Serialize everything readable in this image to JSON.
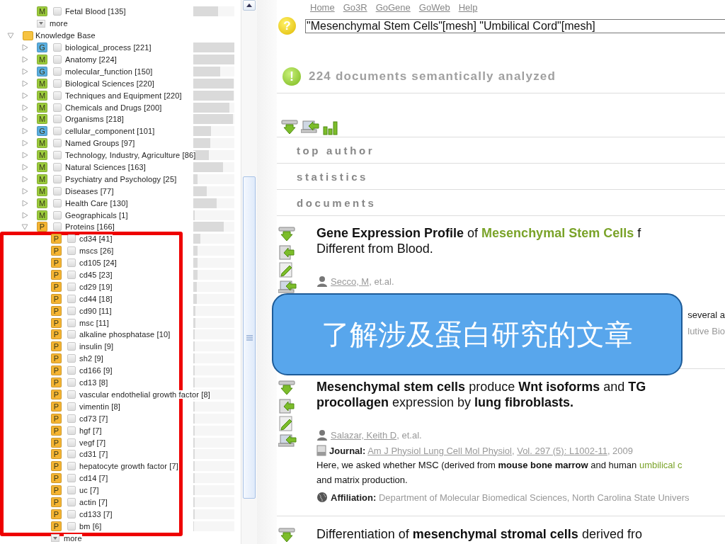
{
  "tree": {
    "top_items": [
      {
        "badge": "M",
        "color": "#9ccc3c",
        "label": "Fetal Blood [135]",
        "checked": false,
        "level": 0.6
      }
    ],
    "top_more": "more",
    "root": {
      "label": "Knowledge Base",
      "expanded": true,
      "children": [
        {
          "badge": "G",
          "color": "#5aaee0",
          "label": "biological_process [221]",
          "checked": false,
          "expanded": false,
          "level": 1.0
        },
        {
          "badge": "M",
          "color": "#9ccc3c",
          "label": "Anatomy [224]",
          "checked": false,
          "expanded": false,
          "level": 1.0
        },
        {
          "badge": "G",
          "color": "#5aaee0",
          "label": "molecular_function [150]",
          "checked": false,
          "expanded": false,
          "level": 0.66
        },
        {
          "badge": "M",
          "color": "#9ccc3c",
          "label": "Biological Sciences [220]",
          "checked": false,
          "expanded": false,
          "level": 0.98
        },
        {
          "badge": "M",
          "color": "#9ccc3c",
          "label": "Techniques and Equipment [220]",
          "checked": false,
          "expanded": false,
          "level": 0.98
        },
        {
          "badge": "M",
          "color": "#9ccc3c",
          "label": "Chemicals and Drugs [200]",
          "checked": false,
          "expanded": false,
          "level": 0.88
        },
        {
          "badge": "M",
          "color": "#9ccc3c",
          "label": "Organisms [218]",
          "checked": false,
          "expanded": false,
          "level": 0.96
        },
        {
          "badge": "G",
          "color": "#5aaee0",
          "label": "cellular_component [101]",
          "checked": false,
          "expanded": false,
          "level": 0.43
        },
        {
          "badge": "M",
          "color": "#9ccc3c",
          "label": "Named Groups [97]",
          "checked": false,
          "expanded": false,
          "level": 0.41
        },
        {
          "badge": "M",
          "color": "#9ccc3c",
          "label": "Technology, Industry, Agriculture [86]",
          "checked": false,
          "expanded": false,
          "level": 0.38
        },
        {
          "badge": "M",
          "color": "#9ccc3c",
          "label": "Natural Sciences [163]",
          "checked": false,
          "expanded": false,
          "level": 0.72
        },
        {
          "badge": "M",
          "color": "#9ccc3c",
          "label": "Psychiatry and Psychology [25]",
          "checked": false,
          "expanded": false,
          "level": 0.1
        },
        {
          "badge": "M",
          "color": "#9ccc3c",
          "label": "Diseases [77]",
          "checked": false,
          "expanded": false,
          "level": 0.33
        },
        {
          "badge": "M",
          "color": "#9ccc3c",
          "label": "Health Care [130]",
          "checked": false,
          "expanded": false,
          "level": 0.57
        },
        {
          "badge": "M",
          "color": "#9ccc3c",
          "label": "Geographicals [1]",
          "checked": false,
          "expanded": false,
          "level": 0.03
        },
        {
          "badge": "P",
          "color": "#f5b432",
          "label": "Proteins [166]",
          "checked": false,
          "expanded": true,
          "level": 0.74,
          "more": "more",
          "children": [
            {
              "badge": "P",
              "color": "#f5b432",
              "label": "cd34 [41]",
              "checked": false,
              "level": 0.18
            },
            {
              "badge": "P",
              "color": "#f5b432",
              "label": "mscs [26]",
              "checked": false,
              "level": 0.11
            },
            {
              "badge": "P",
              "color": "#f5b432",
              "label": "cd105 [24]",
              "checked": false,
              "level": 0.1
            },
            {
              "badge": "P",
              "color": "#f5b432",
              "label": "cd45 [23]",
              "checked": false,
              "level": 0.1
            },
            {
              "badge": "P",
              "color": "#f5b432",
              "label": "cd29 [19]",
              "checked": false,
              "level": 0.08
            },
            {
              "badge": "P",
              "color": "#f5b432",
              "label": "cd44 [18]",
              "checked": false,
              "level": 0.08
            },
            {
              "badge": "P",
              "color": "#f5b432",
              "label": "cd90 [11]",
              "checked": false,
              "level": 0.05
            },
            {
              "badge": "P",
              "color": "#f5b432",
              "label": "msc [11]",
              "checked": false,
              "level": 0.05
            },
            {
              "badge": "P",
              "color": "#f5b432",
              "label": "alkaline phosphatase [10]",
              "checked": false,
              "level": 0.04
            },
            {
              "badge": "P",
              "color": "#f5b432",
              "label": "insulin [9]",
              "checked": false,
              "level": 0.04
            },
            {
              "badge": "P",
              "color": "#f5b432",
              "label": "sh2 [9]",
              "checked": false,
              "level": 0.04
            },
            {
              "badge": "P",
              "color": "#f5b432",
              "label": "cd166 [9]",
              "checked": false,
              "level": 0.04
            },
            {
              "badge": "P",
              "color": "#f5b432",
              "label": "cd13 [8]",
              "checked": false,
              "level": 0.03
            },
            {
              "badge": "P",
              "color": "#f5b432",
              "label": "vascular endothelial growth factor [8]",
              "checked": false,
              "level": 0.03
            },
            {
              "badge": "P",
              "color": "#f5b432",
              "label": "vimentin [8]",
              "checked": false,
              "level": 0.03
            },
            {
              "badge": "P",
              "color": "#f5b432",
              "label": "cd73 [7]",
              "checked": false,
              "level": 0.03
            },
            {
              "badge": "P",
              "color": "#f5b432",
              "label": "hgf [7]",
              "checked": false,
              "level": 0.03
            },
            {
              "badge": "P",
              "color": "#f5b432",
              "label": "vegf [7]",
              "checked": false,
              "level": 0.03
            },
            {
              "badge": "P",
              "color": "#f5b432",
              "label": "cd31 [7]",
              "checked": false,
              "level": 0.03
            },
            {
              "badge": "P",
              "color": "#f5b432",
              "label": "hepatocyte growth factor [7]",
              "checked": false,
              "level": 0.03
            },
            {
              "badge": "P",
              "color": "#f5b432",
              "label": "cd14 [7]",
              "checked": false,
              "level": 0.03
            },
            {
              "badge": "P",
              "color": "#f5b432",
              "label": "uc [7]",
              "checked": false,
              "level": 0.03
            },
            {
              "badge": "P",
              "color": "#f5b432",
              "label": "actin [7]",
              "checked": false,
              "level": 0.03
            },
            {
              "badge": "P",
              "color": "#f5b432",
              "label": "cd133 [7]",
              "checked": false,
              "level": 0.03
            },
            {
              "badge": "P",
              "color": "#f5b432",
              "label": "bm [6]",
              "checked": false,
              "level": 0.02
            }
          ]
        }
      ]
    }
  },
  "nav_links": [
    "Home",
    "Go3R",
    "GoGene",
    "GoWeb",
    "Help"
  ],
  "search": {
    "help_icon": "?",
    "value": "\"Mesenchymal Stem Cells\"[mesh] \"Umbilical Cord\"[mesh]"
  },
  "status": {
    "icon": "!",
    "message": "224 documents semantically analyzed"
  },
  "sections": [
    "top author",
    "statistics",
    "documents"
  ],
  "documents": [
    {
      "title_lines": [
        [
          {
            "text": "Gene Expression Profile",
            "kind": "bold"
          },
          {
            "text": " of ",
            "kind": "plain"
          },
          {
            "text": "Mesenchymal Stem Cells",
            "kind": "term"
          },
          {
            "text": " f",
            "kind": "plain"
          }
        ],
        [
          {
            "text": "Different from Blood.",
            "kind": "plain"
          }
        ]
      ],
      "authors": [
        {
          "text": "Secco, M",
          "kind": "link"
        },
        {
          "text": ", et.al.",
          "kind": "plain"
        }
      ],
      "tail_lines": [
        {
          "text": "several a",
          "kind": "abstract"
        },
        {
          "text": "lutive Bio",
          "kind": "affiliation"
        }
      ]
    },
    {
      "title_lines": [
        [
          {
            "text": "Mesenchymal stem cells",
            "kind": "bold"
          },
          {
            "text": " produce ",
            "kind": "plain"
          },
          {
            "text": "Wnt isoforms",
            "kind": "bold"
          },
          {
            "text": " and ",
            "kind": "plain"
          },
          {
            "text": "TG",
            "kind": "bold"
          }
        ],
        [
          {
            "text": "procollagen",
            "kind": "bold"
          },
          {
            "text": " expression by ",
            "kind": "plain"
          },
          {
            "text": "lung fibroblasts.",
            "kind": "bold"
          }
        ]
      ],
      "authors": [
        {
          "text": "Salazar, Keith D",
          "kind": "link"
        },
        {
          "text": ", et.al.",
          "kind": "plain"
        }
      ],
      "journal": {
        "label": "Journal:",
        "parts": [
          {
            "text": "Am J Physiol Lung Cell Mol Physiol",
            "kind": "link"
          },
          {
            "text": ", ",
            "kind": "plain"
          },
          {
            "text": "Vol. 297 (5): L1002-11",
            "kind": "link"
          },
          {
            "text": ", 2009",
            "kind": "plain"
          }
        ]
      },
      "abstract_lines": [
        [
          {
            "text": "Here, we asked whether MSC (derived from ",
            "kind": "plain"
          },
          {
            "text": "mouse bone marrow",
            "kind": "bold"
          },
          {
            "text": " and human ",
            "kind": "plain"
          },
          {
            "text": "umbilical c",
            "kind": "term"
          }
        ],
        [
          {
            "text": "and matrix production.",
            "kind": "plain"
          }
        ]
      ],
      "affiliation": {
        "label": "Affiliation:",
        "text": "Department of Molecular Biomedical Sciences, North Carolina State Univers"
      }
    },
    {
      "title_lines": [
        [
          {
            "text": "Differentiation of ",
            "kind": "plain"
          },
          {
            "text": "mesenchymal stromal cells",
            "kind": "bold"
          },
          {
            "text": " derived fro",
            "kind": "plain"
          }
        ]
      ]
    }
  ],
  "callout": "了解涉及蛋白研究的文章"
}
